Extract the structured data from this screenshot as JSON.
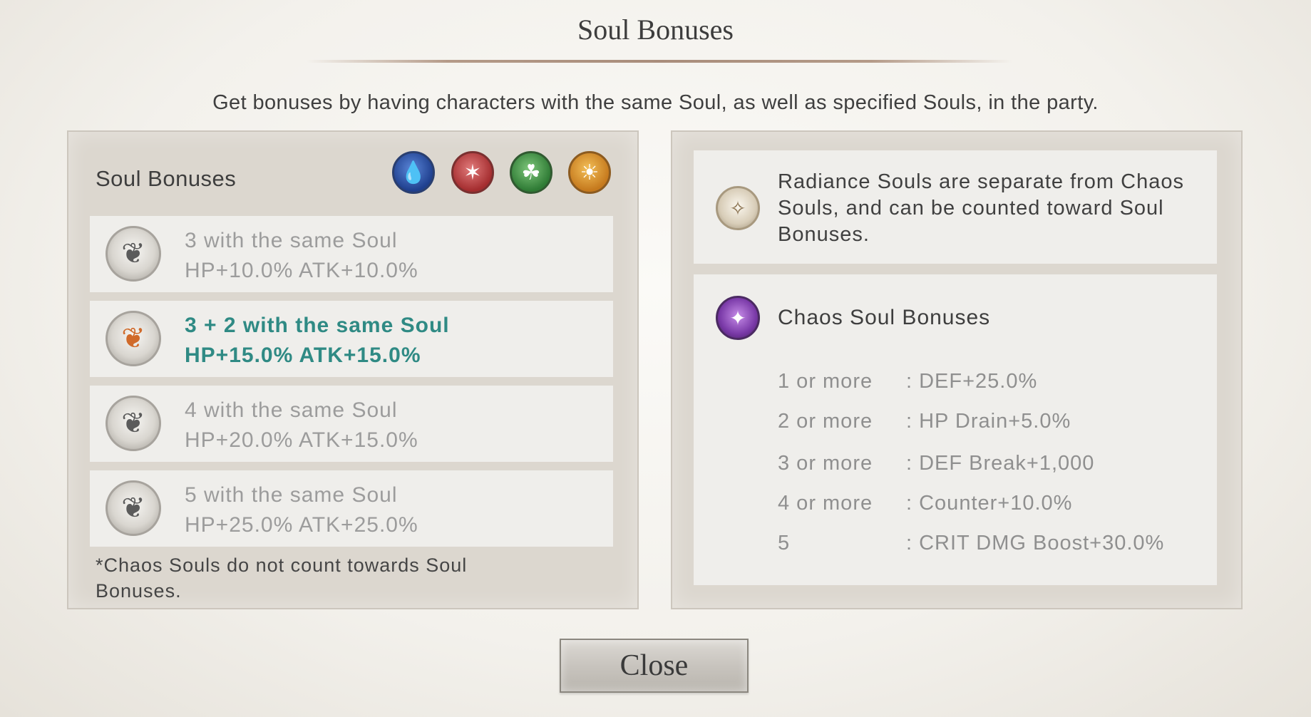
{
  "dialog": {
    "title": "Soul Bonuses",
    "subtitle": "Get bonuses by having characters with the same Soul, as well as specified Souls, in the party."
  },
  "left_panel": {
    "title": "Soul Bonuses",
    "soul_icons": [
      "water-soul-icon",
      "fire-soul-icon",
      "earth-soul-icon",
      "light-soul-icon"
    ],
    "bonuses": [
      {
        "condition": "3 with the same Soul",
        "effect": "HP+10.0% ATK+10.0%",
        "active": false
      },
      {
        "condition": "3 + 2 with the same Soul",
        "effect": "HP+15.0% ATK+15.0%",
        "active": true
      },
      {
        "condition": "4 with the same Soul",
        "effect": "HP+20.0% ATK+15.0%",
        "active": false
      },
      {
        "condition": "5 with the same Soul",
        "effect": "HP+25.0% ATK+25.0%",
        "active": false
      }
    ],
    "footnote": "*Chaos Souls do not count towards Soul Bonuses."
  },
  "right_panel": {
    "radiance_note": "Radiance Souls are separate from Chaos Souls, and can be counted toward Soul Bonuses.",
    "chaos_title": "Chaos Soul Bonuses",
    "chaos_bonuses": [
      {
        "count": "1 or more",
        "effect": ": DEF+25.0%"
      },
      {
        "count": "2 or more",
        "effect": ": HP Drain+5.0%"
      },
      {
        "count": "3 or more",
        "effect": ": DEF Break+1,000"
      },
      {
        "count": "4 or more",
        "effect": ": Counter+10.0%"
      },
      {
        "count": "5",
        "effect": ": CRIT DMG Boost+30.0%"
      }
    ]
  },
  "close_button": {
    "label": "Close"
  },
  "colors": {
    "active_text": "#2f8a84",
    "inactive_text": "#9c9c9c"
  }
}
